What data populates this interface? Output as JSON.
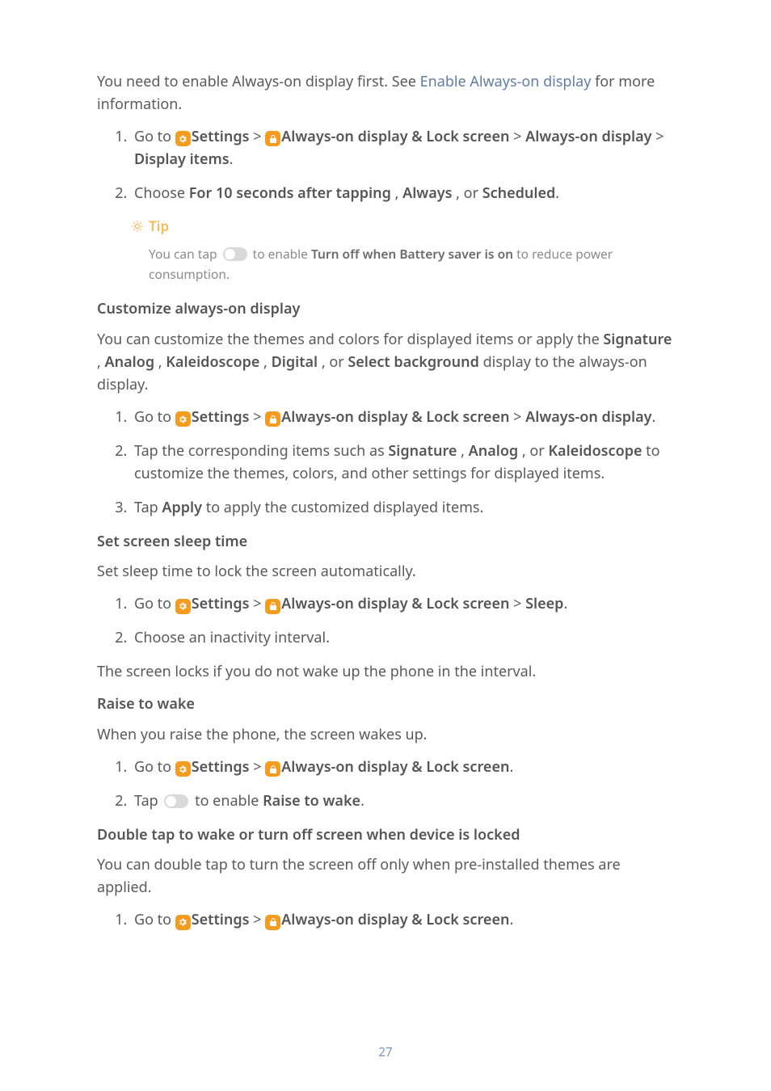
{
  "intro": {
    "prefix": "You need to enable Always-on display first. See ",
    "link": "Enable Always-on display",
    "suffix": " for more information."
  },
  "s1": {
    "li1": {
      "goto": "Go to ",
      "settings": "Settings",
      "sep1": " > ",
      "always_lock": "Always-on display & Lock screen",
      "sep2": " > ",
      "always": "Always-on display",
      "sep3": " > ",
      "display_items": "Display items",
      "end": "."
    },
    "li2": {
      "pre": "Choose ",
      "opt1": "For 10 seconds after tapping",
      "sep1": " , ",
      "opt2": "Always",
      "sep2": " , or ",
      "opt3": "Scheduled",
      "end": "."
    }
  },
  "tip": {
    "label": "Tip",
    "pre": "You can tap ",
    "mid": " to enable ",
    "bold": "Turn off when Battery saver is on",
    "end": " to reduce power consumption."
  },
  "customize": {
    "heading": "Customize always-on display",
    "p1_pre": "You can customize the themes and colors for displayed items or apply the ",
    "sig": "Signature",
    "sep1": " , ",
    "analog": "Analog",
    "sep2": " , ",
    "kal": "Kaleidoscope",
    "sep3": " , ",
    "digital": "Digital",
    "sep4": " , or ",
    "selbg": "Select background",
    "p1_post": " display to the always-on display.",
    "li1": {
      "goto": "Go to ",
      "settings": "Settings",
      "sep1": " > ",
      "always_lock": "Always-on display & Lock screen",
      "sep2": " > ",
      "always": "Always-on display",
      "end": "."
    },
    "li2": {
      "pre": "Tap the corresponding items such as ",
      "sig": "Signature",
      "sep1": " , ",
      "analog": "Analog",
      "sep2": " , or ",
      "kal": "Kaleidoscope",
      "post": " to customize the themes, colors, and other settings for displayed items."
    },
    "li3": {
      "pre": "Tap ",
      "apply": "Apply",
      "post": " to apply the customized displayed items."
    }
  },
  "sleep": {
    "heading": "Set screen sleep time",
    "intro": "Set sleep time to lock the screen automatically.",
    "li1": {
      "goto": "Go to ",
      "settings": "Settings",
      "sep1": " > ",
      "always_lock": "Always-on display & Lock screen",
      "sep2": " > ",
      "sleep": "Sleep",
      "end": "."
    },
    "li2": "Choose an inactivity interval.",
    "outro": "The screen locks if you do not wake up the phone in the interval."
  },
  "raise": {
    "heading": "Raise to wake",
    "intro": "When you raise the phone, the screen wakes up.",
    "li1": {
      "goto": "Go to ",
      "settings": "Settings",
      "sep1": " > ",
      "always_lock": "Always-on display & Lock screen",
      "end": "."
    },
    "li2": {
      "pre": "Tap ",
      "mid": " to enable ",
      "bold": "Raise to wake",
      "end": "."
    }
  },
  "doubletap": {
    "heading": "Double tap to wake or turn off screen when device is locked",
    "intro": "You can double tap to turn the screen off only when pre-installed themes are applied.",
    "li1": {
      "goto": "Go to ",
      "settings": "Settings",
      "sep1": " > ",
      "always_lock": "Always-on display & Lock screen",
      "end": "."
    }
  },
  "page": "27"
}
